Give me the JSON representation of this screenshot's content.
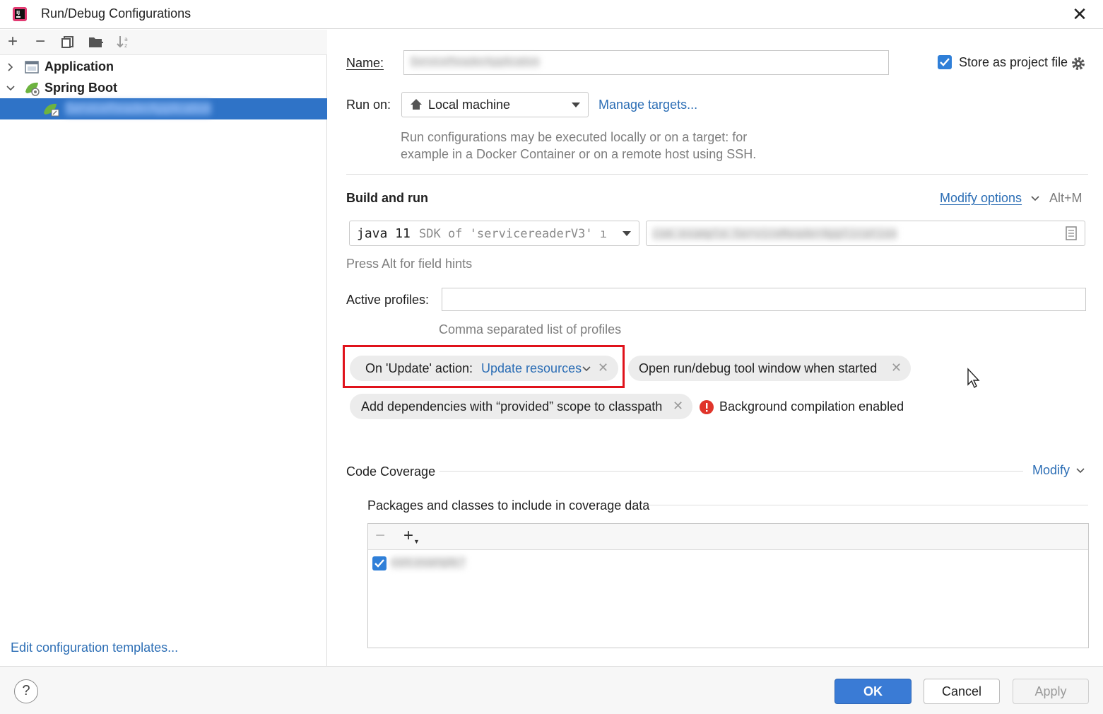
{
  "window": {
    "title": "Run/Debug Configurations"
  },
  "sidebar": {
    "items": [
      {
        "label": "Application"
      },
      {
        "label": "Spring Boot"
      }
    ],
    "selected_child": {
      "label": "ServiceReaderApplication"
    },
    "footer_link": "Edit configuration templates..."
  },
  "form": {
    "name_label": "Name:",
    "name_value": "ServiceReaderApplication",
    "store_label": "Store as project file",
    "run_on_label": "Run on:",
    "run_on_value": "Local machine",
    "manage_targets": "Manage targets...",
    "run_on_hint_1": "Run configurations may be executed locally or on a target: for",
    "run_on_hint_2": "example in a Docker Container or on a remote host using SSH.",
    "build_run_title": "Build and run",
    "modify_options": "Modify options",
    "modify_shortcut": "Alt+M",
    "jdk_java": "java 11",
    "jdk_sdk": "SDK of 'servicereaderV3' ı",
    "main_class": "com.example.ServiceReaderApplication",
    "field_hints": "Press Alt for field hints",
    "active_profiles_label": "Active profiles:",
    "active_profiles_value": "",
    "profiles_hint": "Comma separated list of profiles",
    "chip_update_prefix": "On 'Update' action:",
    "chip_update_value": "Update resources",
    "chip_open_window": "Open run/debug tool window when started",
    "chip_provided": "Add dependencies with “provided” scope to classpath",
    "bg_compilation": "Background compilation enabled"
  },
  "coverage": {
    "title": "Code Coverage",
    "modify": "Modify",
    "packages_title": "Packages and classes to include in coverage data",
    "items": [
      {
        "label": "com.example.*",
        "checked": true
      }
    ]
  },
  "buttons": {
    "ok": "OK",
    "cancel": "Cancel",
    "apply": "Apply",
    "help": "?"
  },
  "colors": {
    "accent": "#2f73c7",
    "link": "#2c6eb5",
    "highlight_box": "#e0121b",
    "error": "#e0352b"
  }
}
